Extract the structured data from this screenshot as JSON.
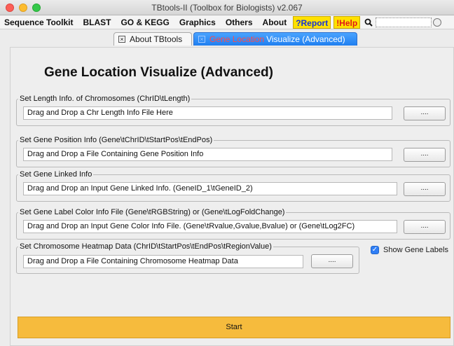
{
  "window": {
    "title": "TBtools-II (Toolbox for Biologists) v2.067"
  },
  "menubar": {
    "items": [
      "Sequence Toolkit",
      "BLAST",
      "GO & KEGG",
      "Graphics",
      "Others",
      "About"
    ],
    "report_label": "?Report",
    "help_label": "!Help"
  },
  "tabs": {
    "about_label": "About TBtools",
    "gene_prefix": "Gene Location",
    "gene_label": "Visualize (Advanced)"
  },
  "main": {
    "heading": "Gene Location Visualize (Advanced)",
    "groups": [
      {
        "legend": "Set Length Info. of Chromosomes (ChrID\\tLength)",
        "field": "Drag and Drop a Chr Length Info File Here",
        "button": "...."
      },
      {
        "legend": "Set Gene Position Info (Gene\\tChrID\\tStartPos\\tEndPos)",
        "field": "Drag and Drop a File Containing Gene Position Info",
        "button": "...."
      },
      {
        "legend": "Set Gene Linked Info",
        "field": "Drag and Drop an Input Gene Linked Info. (GeneID_1\\tGeneID_2)",
        "button": "...."
      },
      {
        "legend": "Set Gene Label Color Info File (Gene\\tRGBString) or (Gene\\tLogFoldChange)",
        "field": "Drag and Drop an Input Gene Color Info File. (Gene\\tRvalue,Gvalue,Bvalue) or (Gene\\tLog2FC)",
        "button": "...."
      },
      {
        "legend": "Set Chromosome Heatmap Data (ChrID\\tStartPos\\tEndPos\\tRegionValue)",
        "field": "Drag and Drop a File Containing Chromosome Heatmap Data",
        "button": "...."
      }
    ],
    "show_labels": {
      "label": "Show Gene Labels",
      "checked": true
    },
    "start_label": "Start"
  }
}
